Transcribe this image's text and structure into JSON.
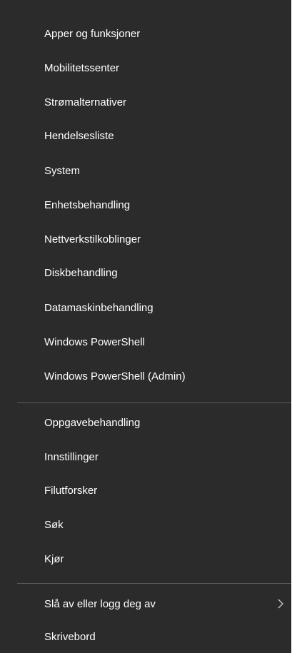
{
  "menu": {
    "items": [
      {
        "label": "Apper og funksjoner"
      },
      {
        "label": "Mobilitetssenter"
      },
      {
        "label": "Strømalternativer"
      },
      {
        "label": "Hendelsesliste"
      },
      {
        "label": "System"
      },
      {
        "label": "Enhetsbehandling"
      },
      {
        "label": "Nettverkstilkoblinger"
      },
      {
        "label": "Diskbehandling"
      },
      {
        "label": "Datamaskinbehandling"
      },
      {
        "label": "Windows PowerShell"
      },
      {
        "label": "Windows PowerShell (Admin)"
      },
      {
        "label": "Oppgavebehandling"
      },
      {
        "label": "Innstillinger"
      },
      {
        "label": "Filutforsker"
      },
      {
        "label": "Søk"
      },
      {
        "label": "Kjør"
      },
      {
        "label": "Slå av eller logg deg av",
        "submenu_icon": "chevron-right-icon"
      },
      {
        "label": "Skrivebord"
      }
    ]
  },
  "colors": {
    "background": "#2b2b2b",
    "text": "#ffffff",
    "separator": "#5b5b5b"
  }
}
